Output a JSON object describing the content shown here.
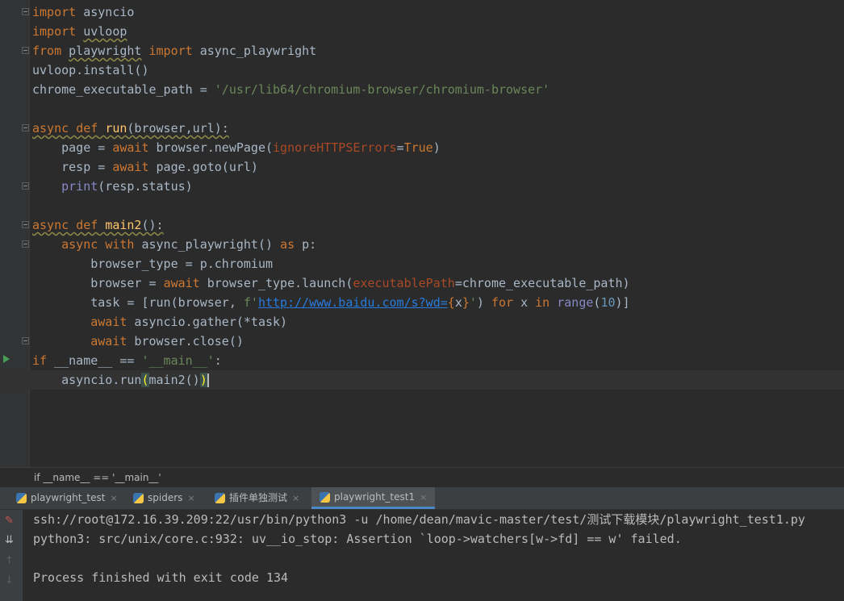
{
  "code": {
    "l1_kw": "import",
    "l1_rest": " asyncio",
    "l2_kw": "import",
    "l2_mod": "uvloop",
    "l3_from": "from",
    "l3_mod": "playwright",
    "l3_import": "import",
    "l3_rest": " async_playwright",
    "l4": "uvloop.install()",
    "l5_a": "chrome_executable_path = ",
    "l5_str": "'/usr/lib64/chromium-browser/chromium-browser'",
    "l7_async": "async",
    "l7_def": "def",
    "l7_fn": "run",
    "l7_rest": "(browser,url):",
    "l8_a": "    page = ",
    "l8_await": "await",
    "l8_b": " browser.newPage(",
    "l8_param": "ignoreHTTPSErrors",
    "l8_eq": "=",
    "l8_true": "True",
    "l8_c": ")",
    "l9_a": "    resp = ",
    "l9_await": "await",
    "l9_b": " page.goto(url)",
    "l10_a": "    ",
    "l10_print": "print",
    "l10_b": "(resp.status)",
    "l12_async": "async",
    "l12_def": "def",
    "l12_fn": "main2",
    "l12_rest": "():",
    "l13_a": "    ",
    "l13_async": "async",
    "l13_with": "with",
    "l13_b": " async_playwright() ",
    "l13_as": "as",
    "l13_c": " p:",
    "l14": "        browser_type = p.chromium",
    "l15_a": "        browser = ",
    "l15_await": "await",
    "l15_b": " browser_type.launch(",
    "l15_param": "executablePath",
    "l15_c": "=chrome_executable_path)",
    "l16_a": "        task = [run(browser, ",
    "l16_f": "f'",
    "l16_url": "http://www.baidu.com/s?wd=",
    "l16_brace1": "{",
    "l16_x": "x",
    "l16_brace2": "}",
    "l16_q": "'",
    "l16_b": ") ",
    "l16_for": "for",
    "l16_c": " x ",
    "l16_in": "in",
    "l16_d": " ",
    "l16_range": "range",
    "l16_e": "(",
    "l16_num": "10",
    "l16_f2": ")]",
    "l17_a": "        ",
    "l17_await": "await",
    "l17_b": " asyncio.gather(*task)",
    "l18_a": "        ",
    "l18_await": "await",
    "l18_b": " browser.close()",
    "l19_if": "if",
    "l19_a": " __name__ == ",
    "l19_str": "'__main__'",
    "l19_b": ":",
    "l20_a": "    asyncio.run",
    "l20_open": "(",
    "l20_b": "main2()",
    "l20_close": ")"
  },
  "breadcrumb": "if __name__ == '__main__'",
  "tabs": [
    {
      "label": "playwright_test",
      "close": "×"
    },
    {
      "label": "spiders",
      "close": "×"
    },
    {
      "label": "插件单独测试",
      "close": "×"
    },
    {
      "label": "playwright_test1",
      "close": "×"
    }
  ],
  "terminal": {
    "line1": "ssh://root@172.16.39.209:22/usr/bin/python3 -u /home/dean/mavic-master/test/测试下载模块/playwright_test1.py",
    "line2": "python3: src/unix/core.c:932: uv__io_stop: Assertion `loop->watchers[w->fd] == w' failed.",
    "line3": "",
    "line4": "Process finished with exit code 134"
  },
  "colors": {
    "keyword": "#cc7832",
    "function": "#ffc66d",
    "string": "#6a8759",
    "number": "#6897bb",
    "background": "#2b2b2b"
  }
}
